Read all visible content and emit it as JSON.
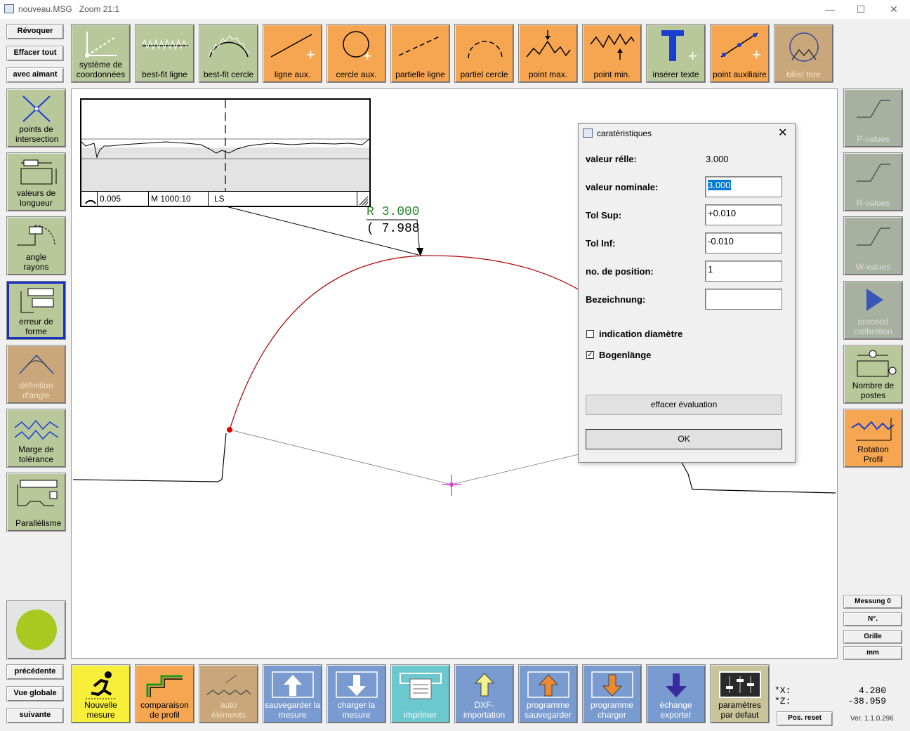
{
  "window": {
    "title": "nouveau.MSG",
    "zoom": "Zoom 21:1",
    "min": "—",
    "max": "☐",
    "close": "✕"
  },
  "left_buttons": {
    "revoquer": "Révoquer",
    "effacer": "Effacer tout",
    "aimant": "avec aimant"
  },
  "toolbar": [
    {
      "label": "système de coordonnées",
      "icon": "coordinate-system-icon"
    },
    {
      "label": "best-fit ligne",
      "icon": "best-fit-line-icon"
    },
    {
      "label": "best-fit cercle",
      "icon": "best-fit-circle-icon"
    },
    {
      "label": "ligne aux.",
      "icon": "aux-line-icon"
    },
    {
      "label": "cercle aux.",
      "icon": "aux-circle-icon"
    },
    {
      "label": "partielle ligne",
      "icon": "partial-line-icon"
    },
    {
      "label": "partiel cercle",
      "icon": "partial-circle-icon"
    },
    {
      "label": "point max.",
      "icon": "point-max-icon"
    },
    {
      "label": "point min.",
      "icon": "point-min-icon"
    },
    {
      "label": "insérer texte",
      "icon": "insert-text-icon"
    },
    {
      "label": "point auxiliaire",
      "icon": "aux-point-icon"
    },
    {
      "label": "bille/ tore",
      "icon": "ball-torus-icon"
    }
  ],
  "left_tools": [
    {
      "label": "points de intersection"
    },
    {
      "label": "valeurs de longueur"
    },
    {
      "label": "angle rayons"
    },
    {
      "label": "erreur de forme"
    },
    {
      "label": "définition d'angle"
    },
    {
      "label": "Marge de tolérance"
    },
    {
      "label": "Parallélisme"
    }
  ],
  "right_tools": [
    {
      "label": "P-values"
    },
    {
      "label": "R-values"
    },
    {
      "label": "W-values"
    },
    {
      "label": "proceed calibration"
    },
    {
      "label": "Nombre de postes"
    },
    {
      "label": "Rotation Profil"
    }
  ],
  "right_small": {
    "messung": "Messung 0",
    "no": "N°.",
    "grille": "Grille",
    "mm": "mm"
  },
  "nav": {
    "prev": "précédente",
    "global": "Vue globale",
    "next": "suivante"
  },
  "bottom_tools": [
    {
      "label": "Nouvelle mesure"
    },
    {
      "label": "comparaison de profil"
    },
    {
      "label": "auto éléments"
    },
    {
      "label": "sauvegarder la mesure"
    },
    {
      "label": "charger la mesure"
    },
    {
      "label": "imprimer"
    },
    {
      "label": "DXF- importation"
    },
    {
      "label": "programme sauvegarder"
    },
    {
      "label": "programme charger"
    },
    {
      "label": "échange exporter"
    },
    {
      "label": "paramètres par defaut"
    }
  ],
  "coords": {
    "x_label": "*X:",
    "x_value": "4.280",
    "z_label": "*Z:",
    "z_value": "-38.959",
    "reset": "Pos. reset",
    "version": "Ver. 1.1.0.296"
  },
  "form_box": {
    "value": "0.005",
    "scale": "M 1000:10",
    "filter": "LS"
  },
  "annotation": {
    "radius": "R 3.000",
    "arc": "( 7.988"
  },
  "dialog": {
    "title": "caratèristiques",
    "valeur_relle_label": "valeur rélle:",
    "valeur_relle_value": "3.000",
    "nominale_label": "valeur nominale:",
    "nominale_value": "3.000",
    "tol_sup_label": "Tol Sup:",
    "tol_sup_value": "+0.010",
    "tol_inf_label": "Tol Inf:",
    "tol_inf_value": "-0.010",
    "position_label": "no. de position:",
    "position_value": "1",
    "bezeichnung_label": "Bezeichnung:",
    "bezeichnung_value": "",
    "diametre_label": "indication diamètre",
    "diametre_checked": false,
    "bogen_label": "Bogenlänge",
    "bogen_checked": true,
    "effacer_label": "effacer évaluation",
    "ok_label": "OK"
  }
}
